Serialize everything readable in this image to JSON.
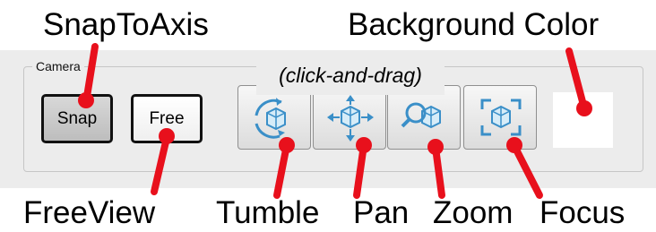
{
  "callouts": {
    "snap_to_axis": "SnapToAxis",
    "background_color": "Background Color",
    "free_view": "FreeView",
    "tumble": "Tumble",
    "pan": "Pan",
    "zoom": "Zoom",
    "focus": "Focus"
  },
  "camera_group": {
    "title": "Camera",
    "snap_label": "Snap",
    "free_label": "Free",
    "drag_hint": "(click-and-drag)",
    "tool_icons": [
      "tumble-icon",
      "pan-icon",
      "zoom-icon",
      "focus-icon"
    ]
  },
  "colors": {
    "pointer": "#e8101c",
    "panel": "#ececec",
    "icon_blue": "#3a8fc8",
    "background_swatch": "#ffffff"
  }
}
